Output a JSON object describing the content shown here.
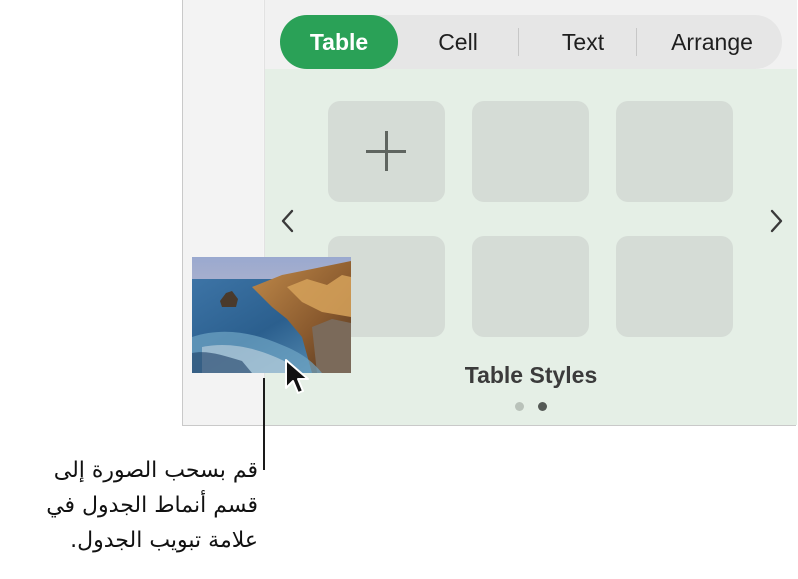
{
  "tabs": [
    {
      "label": "Table",
      "active": true
    },
    {
      "label": "Cell",
      "active": false
    },
    {
      "label": "Text",
      "active": false
    },
    {
      "label": "Arrange",
      "active": false
    }
  ],
  "table_styles": {
    "label": "Table Styles",
    "add_button_icon": "plus-icon",
    "prev_icon": "chevron-left-icon",
    "next_icon": "chevron-right-icon",
    "page_count": 2,
    "current_page": 2
  },
  "dragged_image": {
    "description_icon": "landscape-photo"
  },
  "callout": {
    "lines": [
      "قم بسحب الصورة إلى",
      "قسم أنماط الجدول في",
      "علامة تبويب الجدول."
    ]
  },
  "colors": {
    "accent": "#2aa157",
    "panel_bg": "#e5efe6",
    "thumb_bg": "#d5dcd6"
  }
}
